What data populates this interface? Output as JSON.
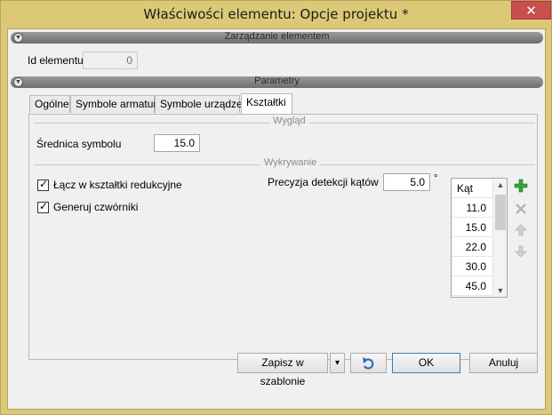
{
  "window": {
    "title": "Właściwości elementu: Opcje projektu *",
    "close_glyph": "✕"
  },
  "element_section": {
    "header": "Zarządzanie elementem",
    "id_label": "Id elementu",
    "id_value": "0"
  },
  "params_section": {
    "header": "Parametry"
  },
  "tabs": [
    {
      "label": "Ogólne",
      "active": false
    },
    {
      "label": "Symbole armatury",
      "active": false
    },
    {
      "label": "Symbole urządzeń",
      "active": false
    },
    {
      "label": "Kształtki",
      "active": true
    }
  ],
  "appearance": {
    "group_label": "Wygląd",
    "symbol_diameter_label": "Średnica symbolu",
    "symbol_diameter_value": "15.0"
  },
  "detection": {
    "group_label": "Wykrywanie",
    "reducers": {
      "label": "Łącz w kształtki redukcyjne",
      "checked": true
    },
    "crosses": {
      "label": "Generuj czwórniki",
      "checked": true
    },
    "precision_label": "Precyzja detekcji kątów",
    "precision_value": "5.0",
    "precision_unit": "°",
    "angle_list": {
      "header": "Kąt",
      "values": [
        "11.0",
        "15.0",
        "22.0",
        "30.0",
        "45.0"
      ]
    }
  },
  "side_buttons": {
    "add": "plus-icon",
    "delete": "x-icon",
    "up": "up-arrow-icon",
    "down": "down-arrow-icon"
  },
  "footer": {
    "save_template": "Zapisz w szablonie",
    "dropdown_glyph": "▾",
    "ok": "OK",
    "cancel": "Anuluj"
  },
  "colors": {
    "title_bar": "#dcc977",
    "close_button": "#c7504f",
    "add_green": "#3aa33a"
  }
}
